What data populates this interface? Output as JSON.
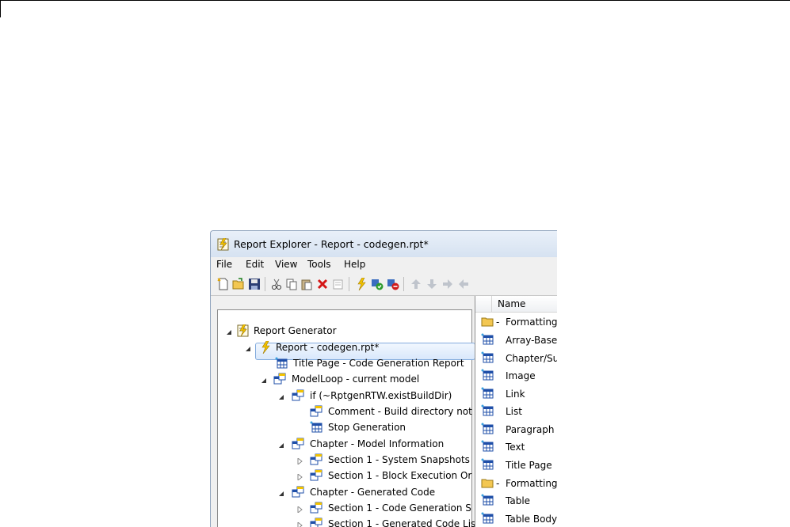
{
  "window": {
    "title": "Report Explorer - Report - codegen.rpt*"
  },
  "menu": [
    "File",
    "Edit",
    "View",
    "Tools",
    "Help"
  ],
  "toolbar": {
    "buttons": [
      "new-file-icon",
      "open-folder-icon",
      "save-icon",
      "cut-icon",
      "copy-icon",
      "paste-icon",
      "delete-icon",
      "properties-icon",
      "run-report-icon",
      "accept-icon",
      "reject-icon",
      "move-up-icon",
      "move-down-icon",
      "move-right-icon",
      "move-left-icon"
    ]
  },
  "tree": [
    {
      "label": "Report Generator",
      "expanded": true
    },
    {
      "label": "Report - codegen.rpt*",
      "expanded": true,
      "selected": true
    },
    {
      "label": "Title Page - Code Generation Report"
    },
    {
      "label": "ModelLoop - current model",
      "expanded": true
    },
    {
      "label": "if (~RptgenRTW.existBuildDir)",
      "expanded": true
    },
    {
      "label": "Comment - Build directory not"
    },
    {
      "label": "Stop Generation"
    },
    {
      "label": "Chapter - Model Information",
      "expanded": true
    },
    {
      "label": "Section 1 - System Snapshots",
      "expanded": false
    },
    {
      "label": "Section 1 - Block Execution Or",
      "expanded": false
    },
    {
      "label": "Chapter - Generated Code",
      "expanded": true
    },
    {
      "label": "Section 1 - Code Generation S",
      "expanded": false
    },
    {
      "label": "Section 1 - Generated Code Lis",
      "expanded": false
    }
  ],
  "list": {
    "header": "Name",
    "items": [
      {
        "label": "Formatting",
        "type": "folder"
      },
      {
        "label": "Array-Base",
        "type": "component"
      },
      {
        "label": "Chapter/Su",
        "type": "component"
      },
      {
        "label": "Image",
        "type": "component"
      },
      {
        "label": "Link",
        "type": "component"
      },
      {
        "label": "List",
        "type": "component"
      },
      {
        "label": "Paragraph",
        "type": "component"
      },
      {
        "label": "Text",
        "type": "component"
      },
      {
        "label": "Title Page",
        "type": "component"
      },
      {
        "label": "Formatting",
        "type": "folder"
      },
      {
        "label": "Table",
        "type": "component"
      },
      {
        "label": "Table Body",
        "type": "component"
      }
    ]
  },
  "colors": {
    "selection_border": "#84acdd",
    "titlebar": "#dbe4f0",
    "folder": "#f3c752",
    "component_blue": "#1f4fa8"
  }
}
